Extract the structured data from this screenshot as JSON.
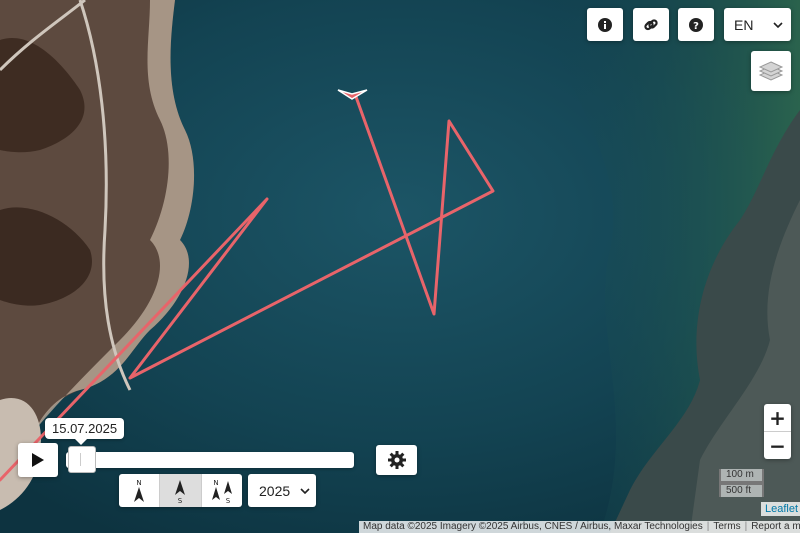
{
  "top_controls": {
    "info_icon": "info-circle-icon",
    "link_icon": "link-icon",
    "help_icon": "question-circle-icon",
    "language": "EN"
  },
  "layers_icon": "layers-icon",
  "zoom": {
    "in_label": "+",
    "out_label": "−"
  },
  "scale": {
    "metric": "100 m",
    "imperial": "500 ft"
  },
  "playback": {
    "play_icon": "play-icon",
    "date": "15.07.2025",
    "position": 0.0,
    "settings_icon": "gear-icon",
    "year": "2025",
    "orientation_modes": [
      {
        "name": "north-up",
        "top": "N",
        "bottom": ""
      },
      {
        "name": "south-up",
        "top": "",
        "bottom": "S"
      },
      {
        "name": "both",
        "top": "N",
        "bottom": "S"
      }
    ],
    "active_orientation": 1
  },
  "attribution": {
    "leaflet": "Leaflet",
    "map_data": "Map data ©2025 Imagery ©2025 Airbus, CNES / Airbus, Maxar Technologies",
    "terms": "Terms",
    "report": "Report a map error"
  },
  "colors": {
    "track": "#e8646a",
    "water": "#123f4d"
  }
}
